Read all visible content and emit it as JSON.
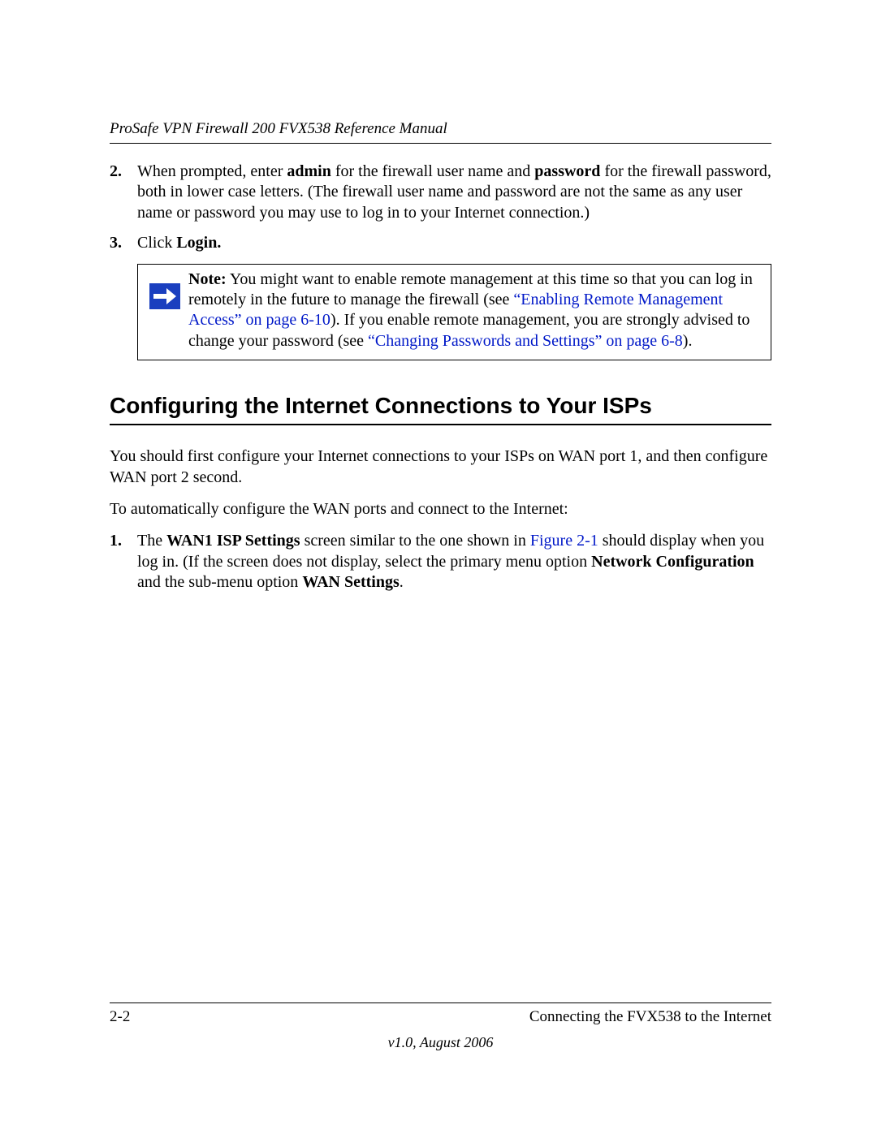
{
  "header": {
    "title": "ProSafe VPN Firewall 200 FVX538 Reference Manual"
  },
  "steps": {
    "s2": {
      "num": "2.",
      "t1": "When prompted, enter ",
      "b1": "admin",
      "t2": " for the firewall user name and ",
      "b2": "password",
      "t3": " for the firewall password, both in lower case letters. (The firewall user name and password are not the same as any user name or password you may use to log in to your Internet connection.)"
    },
    "s3": {
      "num": "3.",
      "t1": "Click ",
      "b1": "Login."
    }
  },
  "note": {
    "label": "Note:",
    "t1": " You might want to enable remote management at this time so that you can log in remotely in the future to manage the firewall (see ",
    "link1": "“Enabling Remote Management Access” on page 6-10",
    "t2": "). If you enable remote management, you are strongly advised to change your password (see ",
    "link2": "“Changing Passwords and Settings” on page 6-8",
    "t3": ")."
  },
  "section": {
    "heading": "Configuring the Internet Connections to Your ISPs",
    "p1": "You should first configure your Internet connections to your ISPs on WAN port 1, and then configure WAN port 2 second.",
    "p2": "To automatically configure the WAN ports and connect to the Internet:",
    "s1": {
      "num": "1.",
      "t1": "The ",
      "b1": "WAN1 ISP Settings",
      "t2": " screen similar to the one shown in ",
      "link1": "Figure 2-1",
      "t3": " should display when you log in. (If the screen does not display, select the primary menu option ",
      "b2": "Network Configuration",
      "t4": " and the sub-menu option ",
      "b3": "WAN Settings",
      "t5": "."
    }
  },
  "footer": {
    "page": "2-2",
    "chapter": "Connecting the FVX538 to the Internet",
    "version": "v1.0, August 2006"
  }
}
